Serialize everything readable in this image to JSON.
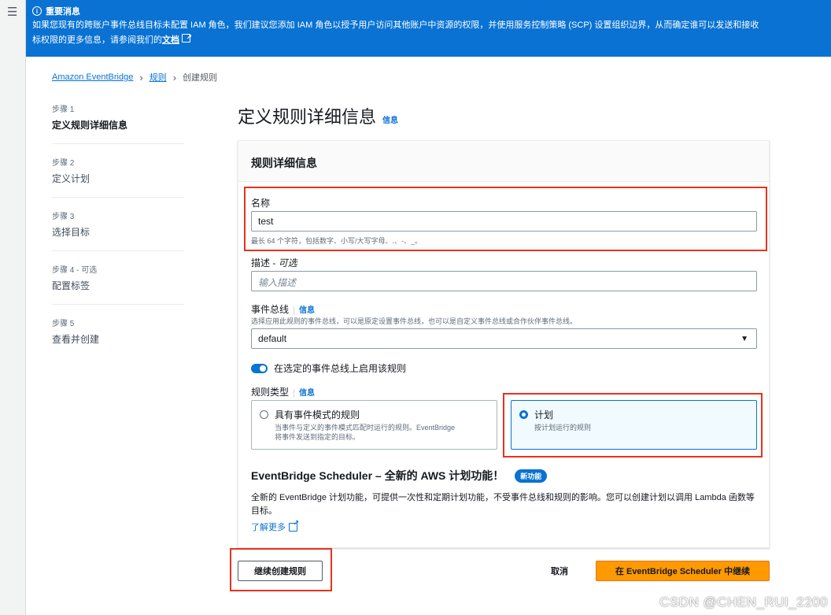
{
  "banner": {
    "title": "重要消息",
    "line1": "如果您现有的跨账户事件总线目标未配置 IAM 角色，我们建议您添加 IAM 角色以授予用户访问其他账户中资源的权限，并使用服务控制策略 (SCP) 设置组织边界，从而确定谁可以发送和接收",
    "line2_prefix": "标权限的更多信息，请参阅我们的",
    "doc_link": "文档"
  },
  "breadcrumb": {
    "root": "Amazon EventBridge",
    "rules": "规则",
    "current": "创建规则"
  },
  "steps": [
    {
      "num": "步骤 1",
      "label": "定义规则详细信息"
    },
    {
      "num": "步骤 2",
      "label": "定义计划"
    },
    {
      "num": "步骤 3",
      "label": "选择目标"
    },
    {
      "num": "步骤 4 - 可选",
      "label": "配置标签"
    },
    {
      "num": "步骤 5",
      "label": "查看并创建"
    }
  ],
  "page": {
    "title": "定义规则详细信息",
    "info": "信息"
  },
  "panel": {
    "header": "规则详细信息",
    "name": {
      "label": "名称",
      "value": "test",
      "hint": "最长 64 个字符，包括数字、小写/大写字母、.、-、_。"
    },
    "description": {
      "label": "描述 - ",
      "optional": "可选",
      "placeholder": "输入描述"
    },
    "event_bus": {
      "label": "事件总线",
      "info": "信息",
      "hint": "选择应用此规则的事件总线，可以是原定设置事件总线，也可以是自定义事件总线或合作伙伴事件总线。",
      "value": "default"
    },
    "toggle_label": "在选定的事件总线上启用该规则",
    "rule_type": {
      "label": "规则类型",
      "info": "信息",
      "options": [
        {
          "title": "具有事件模式的规则",
          "desc1": "当事件与定义的事件模式匹配时运行的规则。EventBridge",
          "desc2": "将事件发送到指定的目标。"
        },
        {
          "title": "计划",
          "desc1": "按计划运行的规则"
        }
      ]
    },
    "scheduler": {
      "title": "EventBridge Scheduler – 全新的 AWS 计划功能！",
      "badge": "新功能",
      "text": "全新的 EventBridge 计划功能，可提供一次性和定期计划功能，不受事件总线和规则的影响。您可以创建计划以调用 Lambda 函数等目标。",
      "learn_more": "了解更多"
    }
  },
  "footer": {
    "continue_rule": "继续创建规则",
    "cancel": "取消",
    "continue_scheduler": "在 EventBridge Scheduler 中继续"
  },
  "watermark": "CSDN @CHEN_RUI_2200",
  "colors": {
    "accent": "#0972d3",
    "primary_button": "#ff9900",
    "highlight": "#e8321e"
  }
}
